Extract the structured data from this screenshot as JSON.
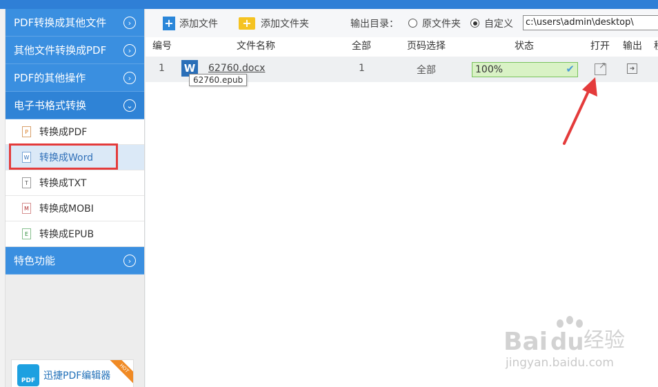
{
  "sidebar": {
    "categories": [
      {
        "label": "PDF转换成其他文件"
      },
      {
        "label": "其他文件转换成PDF"
      },
      {
        "label": "PDF的其他操作"
      },
      {
        "label": "电子书格式转换"
      },
      {
        "label": "特色功能"
      }
    ],
    "subitems": [
      {
        "label": "转换成PDF",
        "icon_letter": "P"
      },
      {
        "label": "转换成Word",
        "icon_letter": "W"
      },
      {
        "label": "转换成TXT",
        "icon_letter": "T"
      },
      {
        "label": "转换成MOBI",
        "icon_letter": "M"
      },
      {
        "label": "转换成EPUB",
        "icon_letter": "E"
      }
    ],
    "promo": {
      "label": "迅捷PDF编辑器",
      "ribbon": "HOT",
      "logo_text": "PDF"
    }
  },
  "toolbar": {
    "add_file": "添加文件",
    "add_folder": "添加文件夹",
    "output_dir_label": "输出目录：",
    "radio_original": "原文件夹",
    "radio_custom": "自定义",
    "path_value": "c:\\users\\admin\\desktop\\"
  },
  "table": {
    "headers": {
      "num": "编号",
      "filename": "文件名称",
      "total": "全部",
      "page_select": "页码选择",
      "status": "状态",
      "open": "打开",
      "output": "输出",
      "extra": "移"
    },
    "rows": [
      {
        "num": "1",
        "icon": "W",
        "filename": "62760.docx",
        "tooltip": "62760.epub",
        "total": "1",
        "page_select": "全部",
        "progress_text": "100%",
        "progress": 1.0
      }
    ]
  },
  "watermark": {
    "brand": "Bai",
    "brand2": "du",
    "suffix": "经验",
    "url": "jingyan.baidu.com"
  },
  "colors": {
    "accent": "#3a8fe0",
    "highlight_box": "#e43b3b",
    "progress_border": "#78c25a"
  }
}
